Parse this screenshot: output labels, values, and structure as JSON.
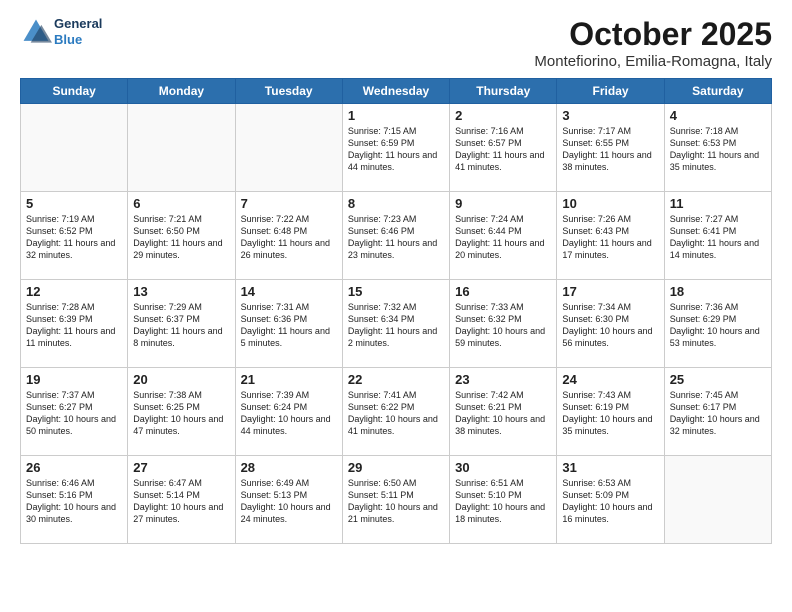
{
  "header": {
    "logo_line1": "General",
    "logo_line2": "Blue",
    "title": "October 2025",
    "subtitle": "Montefiorino, Emilia-Romagna, Italy"
  },
  "days_of_week": [
    "Sunday",
    "Monday",
    "Tuesday",
    "Wednesday",
    "Thursday",
    "Friday",
    "Saturday"
  ],
  "weeks": [
    [
      {
        "num": "",
        "text": ""
      },
      {
        "num": "",
        "text": ""
      },
      {
        "num": "",
        "text": ""
      },
      {
        "num": "1",
        "text": "Sunrise: 7:15 AM\nSunset: 6:59 PM\nDaylight: 11 hours and 44 minutes."
      },
      {
        "num": "2",
        "text": "Sunrise: 7:16 AM\nSunset: 6:57 PM\nDaylight: 11 hours and 41 minutes."
      },
      {
        "num": "3",
        "text": "Sunrise: 7:17 AM\nSunset: 6:55 PM\nDaylight: 11 hours and 38 minutes."
      },
      {
        "num": "4",
        "text": "Sunrise: 7:18 AM\nSunset: 6:53 PM\nDaylight: 11 hours and 35 minutes."
      }
    ],
    [
      {
        "num": "5",
        "text": "Sunrise: 7:19 AM\nSunset: 6:52 PM\nDaylight: 11 hours and 32 minutes."
      },
      {
        "num": "6",
        "text": "Sunrise: 7:21 AM\nSunset: 6:50 PM\nDaylight: 11 hours and 29 minutes."
      },
      {
        "num": "7",
        "text": "Sunrise: 7:22 AM\nSunset: 6:48 PM\nDaylight: 11 hours and 26 minutes."
      },
      {
        "num": "8",
        "text": "Sunrise: 7:23 AM\nSunset: 6:46 PM\nDaylight: 11 hours and 23 minutes."
      },
      {
        "num": "9",
        "text": "Sunrise: 7:24 AM\nSunset: 6:44 PM\nDaylight: 11 hours and 20 minutes."
      },
      {
        "num": "10",
        "text": "Sunrise: 7:26 AM\nSunset: 6:43 PM\nDaylight: 11 hours and 17 minutes."
      },
      {
        "num": "11",
        "text": "Sunrise: 7:27 AM\nSunset: 6:41 PM\nDaylight: 11 hours and 14 minutes."
      }
    ],
    [
      {
        "num": "12",
        "text": "Sunrise: 7:28 AM\nSunset: 6:39 PM\nDaylight: 11 hours and 11 minutes."
      },
      {
        "num": "13",
        "text": "Sunrise: 7:29 AM\nSunset: 6:37 PM\nDaylight: 11 hours and 8 minutes."
      },
      {
        "num": "14",
        "text": "Sunrise: 7:31 AM\nSunset: 6:36 PM\nDaylight: 11 hours and 5 minutes."
      },
      {
        "num": "15",
        "text": "Sunrise: 7:32 AM\nSunset: 6:34 PM\nDaylight: 11 hours and 2 minutes."
      },
      {
        "num": "16",
        "text": "Sunrise: 7:33 AM\nSunset: 6:32 PM\nDaylight: 10 hours and 59 minutes."
      },
      {
        "num": "17",
        "text": "Sunrise: 7:34 AM\nSunset: 6:30 PM\nDaylight: 10 hours and 56 minutes."
      },
      {
        "num": "18",
        "text": "Sunrise: 7:36 AM\nSunset: 6:29 PM\nDaylight: 10 hours and 53 minutes."
      }
    ],
    [
      {
        "num": "19",
        "text": "Sunrise: 7:37 AM\nSunset: 6:27 PM\nDaylight: 10 hours and 50 minutes."
      },
      {
        "num": "20",
        "text": "Sunrise: 7:38 AM\nSunset: 6:25 PM\nDaylight: 10 hours and 47 minutes."
      },
      {
        "num": "21",
        "text": "Sunrise: 7:39 AM\nSunset: 6:24 PM\nDaylight: 10 hours and 44 minutes."
      },
      {
        "num": "22",
        "text": "Sunrise: 7:41 AM\nSunset: 6:22 PM\nDaylight: 10 hours and 41 minutes."
      },
      {
        "num": "23",
        "text": "Sunrise: 7:42 AM\nSunset: 6:21 PM\nDaylight: 10 hours and 38 minutes."
      },
      {
        "num": "24",
        "text": "Sunrise: 7:43 AM\nSunset: 6:19 PM\nDaylight: 10 hours and 35 minutes."
      },
      {
        "num": "25",
        "text": "Sunrise: 7:45 AM\nSunset: 6:17 PM\nDaylight: 10 hours and 32 minutes."
      }
    ],
    [
      {
        "num": "26",
        "text": "Sunrise: 6:46 AM\nSunset: 5:16 PM\nDaylight: 10 hours and 30 minutes."
      },
      {
        "num": "27",
        "text": "Sunrise: 6:47 AM\nSunset: 5:14 PM\nDaylight: 10 hours and 27 minutes."
      },
      {
        "num": "28",
        "text": "Sunrise: 6:49 AM\nSunset: 5:13 PM\nDaylight: 10 hours and 24 minutes."
      },
      {
        "num": "29",
        "text": "Sunrise: 6:50 AM\nSunset: 5:11 PM\nDaylight: 10 hours and 21 minutes."
      },
      {
        "num": "30",
        "text": "Sunrise: 6:51 AM\nSunset: 5:10 PM\nDaylight: 10 hours and 18 minutes."
      },
      {
        "num": "31",
        "text": "Sunrise: 6:53 AM\nSunset: 5:09 PM\nDaylight: 10 hours and 16 minutes."
      },
      {
        "num": "",
        "text": ""
      }
    ]
  ]
}
